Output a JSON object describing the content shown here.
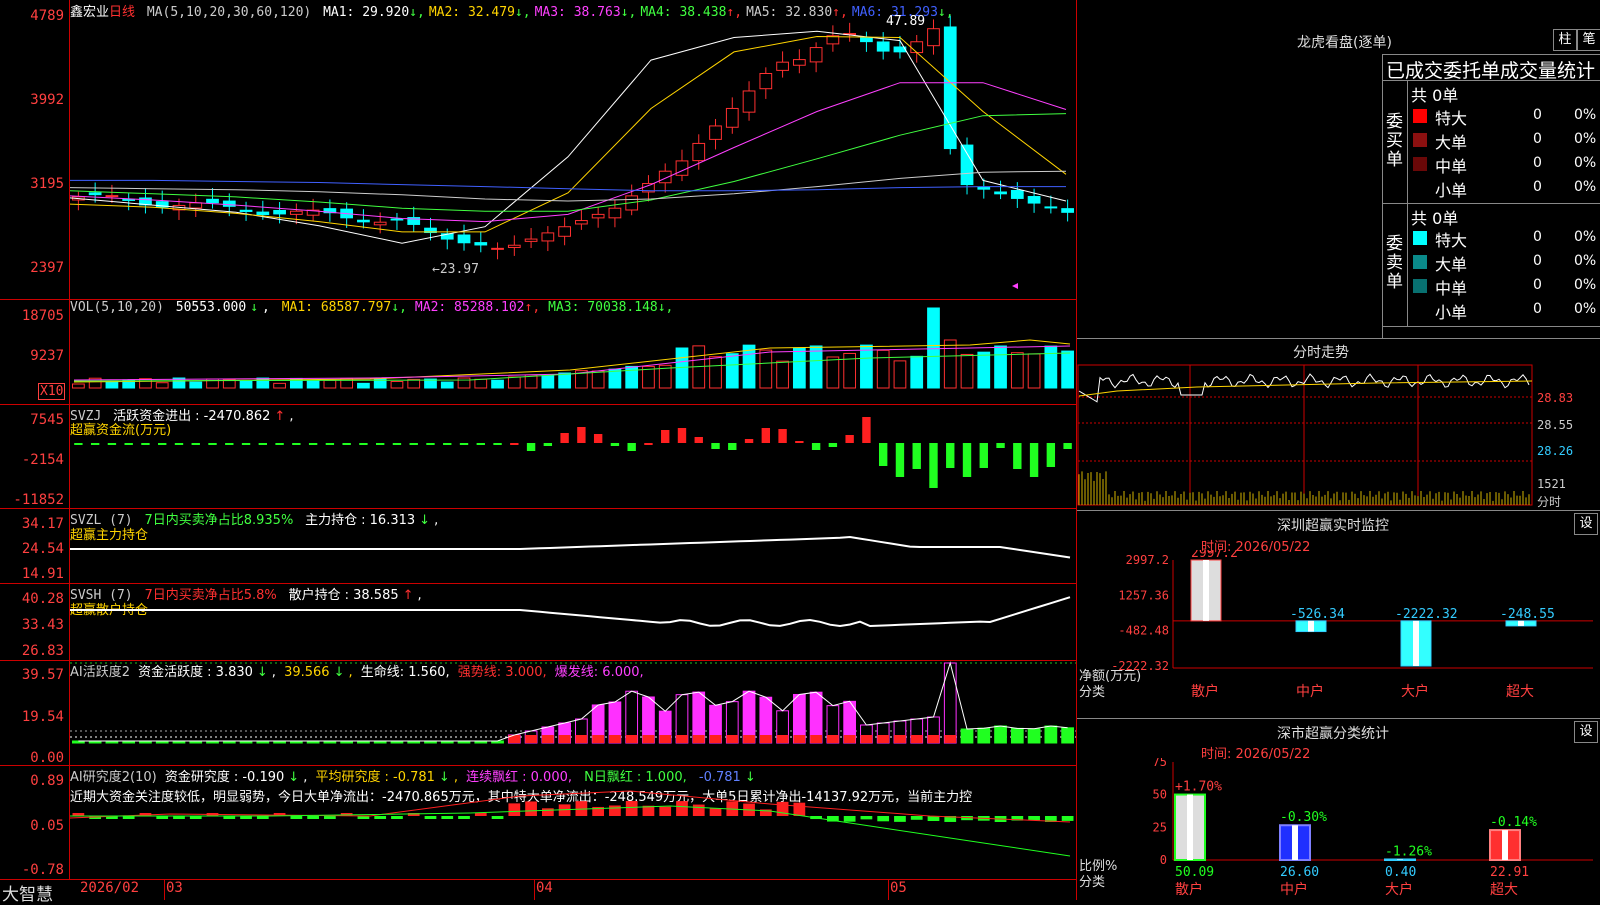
{
  "stock": {
    "name": "鑫宏业",
    "period": "日线"
  },
  "ma_legend": {
    "label": "MA(5,10,20,30,60,120)",
    "items": [
      {
        "name": "MA1",
        "value": "29.920",
        "dir": "↓",
        "color": "#ffffff"
      },
      {
        "name": "MA2",
        "value": "32.479",
        "dir": "↓",
        "color": "#ffd400"
      },
      {
        "name": "MA3",
        "value": "38.763",
        "dir": "↓",
        "color": "#ff40ff"
      },
      {
        "name": "MA4",
        "value": "38.438",
        "dir": "↑",
        "color": "#40ff40"
      },
      {
        "name": "MA5",
        "value": "32.830",
        "dir": "↑",
        "color": "#cccccc"
      },
      {
        "name": "MA6",
        "value": "31.293",
        "dir": "↓",
        "color": "#4060ff"
      }
    ]
  },
  "price_axis": [
    "4789",
    "3992",
    "3195",
    "2397"
  ],
  "price_annotations": {
    "high": "47.89",
    "low": "←23.97"
  },
  "vol_legend": {
    "label": "VOL(5,10,20)",
    "value": "50553.000",
    "dir": "↓",
    "items": [
      {
        "name": "MA1",
        "value": "68587.797",
        "dir": "↓",
        "color": "#ffd400"
      },
      {
        "name": "MA2",
        "value": "85288.102",
        "dir": "↑",
        "color": "#ff40ff"
      },
      {
        "name": "MA3",
        "value": "70038.148",
        "dir": "↓",
        "color": "#40ff40"
      }
    ]
  },
  "vol_axis": [
    "18705",
    "9237",
    "X10"
  ],
  "svzj": {
    "label": "SVZJ",
    "series": "活跃资金进出",
    "value": "-2470.862",
    "dir": "↑",
    "subtitle": "超赢资金流(万元)",
    "axis": [
      "7545",
      "-2154",
      "-11852"
    ]
  },
  "svzl": {
    "label": "SVZL (7)",
    "desc": "7日内买卖净占比8.935%",
    "series": "主力持仓",
    "value": "16.313",
    "dir": "↓",
    "subtitle": "超赢主力持仓",
    "axis": [
      "34.17",
      "24.54",
      "14.91"
    ]
  },
  "svsh": {
    "label": "SVSH (7)",
    "desc": "7日内买卖净占比5.8%",
    "series": "散户持仓",
    "value": "38.585",
    "dir": "↑",
    "subtitle": "超赢散户持仓",
    "axis": [
      "40.28",
      "33.43",
      "26.83"
    ]
  },
  "ai_active": {
    "label": "AI活跃度2",
    "series": "资金活跃度",
    "value": "3.830",
    "dir": "↓",
    "avg": "39.566",
    "life": "生命线: 1.560,",
    "strong": "强势线: 3.000,",
    "burst": "爆发线: 6.000,",
    "axis": [
      "39.57",
      "19.54",
      "0.00"
    ]
  },
  "ai_research": {
    "label": "AI研究度2(10)",
    "series": "资金研究度",
    "value": "-0.190",
    "dir": "↓",
    "avg_label": "平均研究度",
    "avg": "-0.781",
    "avg_dir": "↓",
    "red_label": "连续飘红",
    "red": "0.000,",
    "nred_label": "N日飘红",
    "nred": "1.000,",
    "last": "-0.781",
    "last_dir": "↓",
    "commentary": "近期大资金关注度较低，明显弱势，今日大单净流出：-2470.865万元，其中特大单净流出：-248.549万元，大单5日累计净出-14137.92万元，当前主力控",
    "axis": [
      "0.89",
      "0.05",
      "-0.78"
    ]
  },
  "time_axis": {
    "brand": "大智慧",
    "labels": [
      "2026/02",
      "03",
      "04",
      "05"
    ]
  },
  "right_panel": {
    "lhb_title": "龙虎看盘(逐单)",
    "btn_bar": "柱",
    "btn_pen": "笔",
    "table_title": "已成交委托单成交量统计",
    "buy": {
      "side": "委买单",
      "total": "共 0单",
      "rows": [
        {
          "label": "特大",
          "count": "0",
          "pct": "0%",
          "color": "#ff0000"
        },
        {
          "label": "大单",
          "count": "0",
          "pct": "0%",
          "color": "#8b1010"
        },
        {
          "label": "中单",
          "count": "0",
          "pct": "0%",
          "color": "#6a0808"
        },
        {
          "label": "小单",
          "count": "0",
          "pct": "0%",
          "color": "#000000"
        }
      ]
    },
    "sell": {
      "side": "委卖单",
      "total": "共 0单",
      "rows": [
        {
          "label": "特大",
          "count": "0",
          "pct": "0%",
          "color": "#00ffff"
        },
        {
          "label": "大单",
          "count": "0",
          "pct": "0%",
          "color": "#0a8a8a"
        },
        {
          "label": "中单",
          "count": "0",
          "pct": "0%",
          "color": "#087070"
        },
        {
          "label": "小单",
          "count": "0",
          "pct": "0%",
          "color": "#000000"
        }
      ]
    },
    "intraday": {
      "title": "分时走势",
      "axis": [
        "28.83",
        "28.55",
        "28.26",
        "1521",
        "分时"
      ]
    },
    "sz_monitor": {
      "title": "深圳超赢实时监控",
      "btn": "设",
      "time": "时间: 2026/05/22",
      "axis": [
        "2997.2",
        "1257.36",
        "-482.48",
        "-2222.32"
      ],
      "values": [
        {
          "cat": "散户",
          "val": 2997.2,
          "label": "2997.2"
        },
        {
          "cat": "中户",
          "val": -526.34,
          "label": "-526.34"
        },
        {
          "cat": "大户",
          "val": -2222.32,
          "label": "-2222.32"
        },
        {
          "cat": "超大",
          "val": -248.55,
          "label": "-248.55"
        }
      ],
      "ylabel1": "净额(万元)",
      "ylabel2": "分类"
    },
    "sz_class": {
      "title": "深市超赢分类统计",
      "btn": "设",
      "time": "时间: 2026/05/22",
      "axis": [
        "75",
        "50",
        "25",
        "0"
      ],
      "values": [
        {
          "cat": "散户",
          "pct": "+1.70%",
          "val": 50.09,
          "label": "50.09"
        },
        {
          "cat": "中户",
          "pct": "-0.30%",
          "val": 26.6,
          "label": "26.60"
        },
        {
          "cat": "大户",
          "pct": "-1.26%",
          "val": 0.4,
          "label": "0.40"
        },
        {
          "cat": "超大",
          "pct": "-0.14%",
          "val": 22.91,
          "label": "22.91"
        }
      ],
      "ylabel1": "比例%",
      "ylabel2": "分类"
    }
  },
  "chart_data": {
    "type": "line",
    "title": "鑫宏业 日线",
    "x": [
      "2026/02",
      "03",
      "04",
      "05"
    ],
    "ylim": [
      23.97,
      47.89
    ],
    "series": [
      {
        "name": "MA1",
        "values": [
          30.2,
          29.5,
          28.8,
          27.5,
          25.8,
          27.4,
          34.2,
          43.6,
          45.8,
          46.4,
          45.5,
          31.9,
          29.9
        ]
      },
      {
        "name": "MA2",
        "values": [
          29.6,
          29.3,
          28.7,
          27.9,
          26.9,
          26.9,
          30.7,
          38.9,
          44.4,
          45.9,
          45.8,
          38.6,
          32.5
        ]
      },
      {
        "name": "MA3",
        "values": [
          30.4,
          30.0,
          29.5,
          28.9,
          28.2,
          27.9,
          28.6,
          31.5,
          35.1,
          38.6,
          41.4,
          41.4,
          38.8
        ]
      },
      {
        "name": "MA4",
        "values": [
          30.9,
          30.6,
          30.3,
          29.8,
          29.2,
          28.9,
          28.9,
          30.0,
          31.8,
          34.0,
          36.3,
          38.2,
          38.4
        ]
      },
      {
        "name": "MA5",
        "values": [
          31.2,
          31.1,
          31.0,
          30.8,
          30.5,
          30.1,
          29.9,
          30.1,
          30.6,
          31.3,
          32.1,
          32.7,
          32.8
        ]
      },
      {
        "name": "MA6",
        "values": [
          31.9,
          31.9,
          31.8,
          31.7,
          31.5,
          31.3,
          31.1,
          30.9,
          30.9,
          31.0,
          31.2,
          31.3,
          31.3
        ]
      }
    ]
  }
}
